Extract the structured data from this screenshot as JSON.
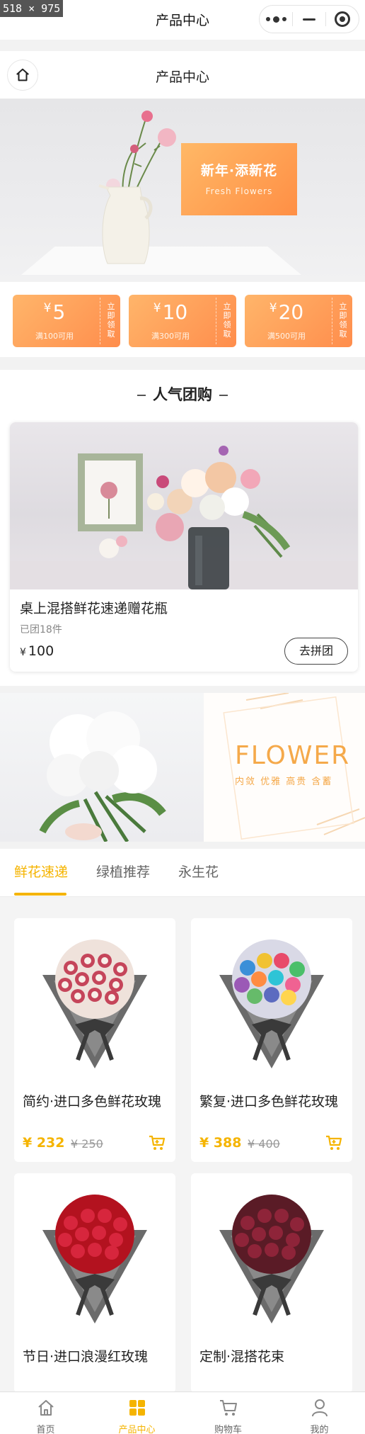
{
  "screenshot_label": "518 × 975",
  "top_bar": {
    "title": "产品中心"
  },
  "nav_bar": {
    "title": "产品中心"
  },
  "banner": {
    "headline": "新年·添新花",
    "subtitle": "Fresh Flowers"
  },
  "coupons": [
    {
      "symbol": "¥",
      "amount": "5",
      "condition": "满100可用",
      "action": "立即领取"
    },
    {
      "symbol": "¥",
      "amount": "10",
      "condition": "满300可用",
      "action": "立即领取"
    },
    {
      "symbol": "¥",
      "amount": "20",
      "condition": "满500可用",
      "action": "立即领取"
    }
  ],
  "group_buy": {
    "section_title": "人气团购",
    "product_name": "桌上混搭鲜花速递赠花瓶",
    "sold": "已团18件",
    "currency": "¥",
    "price": "100",
    "button": "去拼团"
  },
  "flower_banner": {
    "word": "FLOWER",
    "tagline": "内敛  优雅  高贵  含蓄"
  },
  "tabs": [
    {
      "label": "鲜花速递"
    },
    {
      "label": "绿植推荐"
    },
    {
      "label": "永生花"
    }
  ],
  "products": [
    {
      "name": "简约·进口多色鲜花玫瑰",
      "price": "¥ 232",
      "old_price": "¥ 250"
    },
    {
      "name": "繁复·进口多色鲜花玫瑰",
      "price": "¥ 388",
      "old_price": "¥ 400"
    },
    {
      "name": "节日·进口浪漫红玫瑰",
      "price": "",
      "old_price": ""
    },
    {
      "name": "定制·混搭花束",
      "price": "",
      "old_price": ""
    }
  ],
  "tab_bar": [
    {
      "label": "首页",
      "icon": "home-icon"
    },
    {
      "label": "产品中心",
      "icon": "grid-icon"
    },
    {
      "label": "购物车",
      "icon": "cart-icon"
    },
    {
      "label": "我的",
      "icon": "user-icon"
    }
  ],
  "colors": {
    "accent": "#f5b400",
    "coupon": "#ff9a4f",
    "text": "#222222"
  }
}
